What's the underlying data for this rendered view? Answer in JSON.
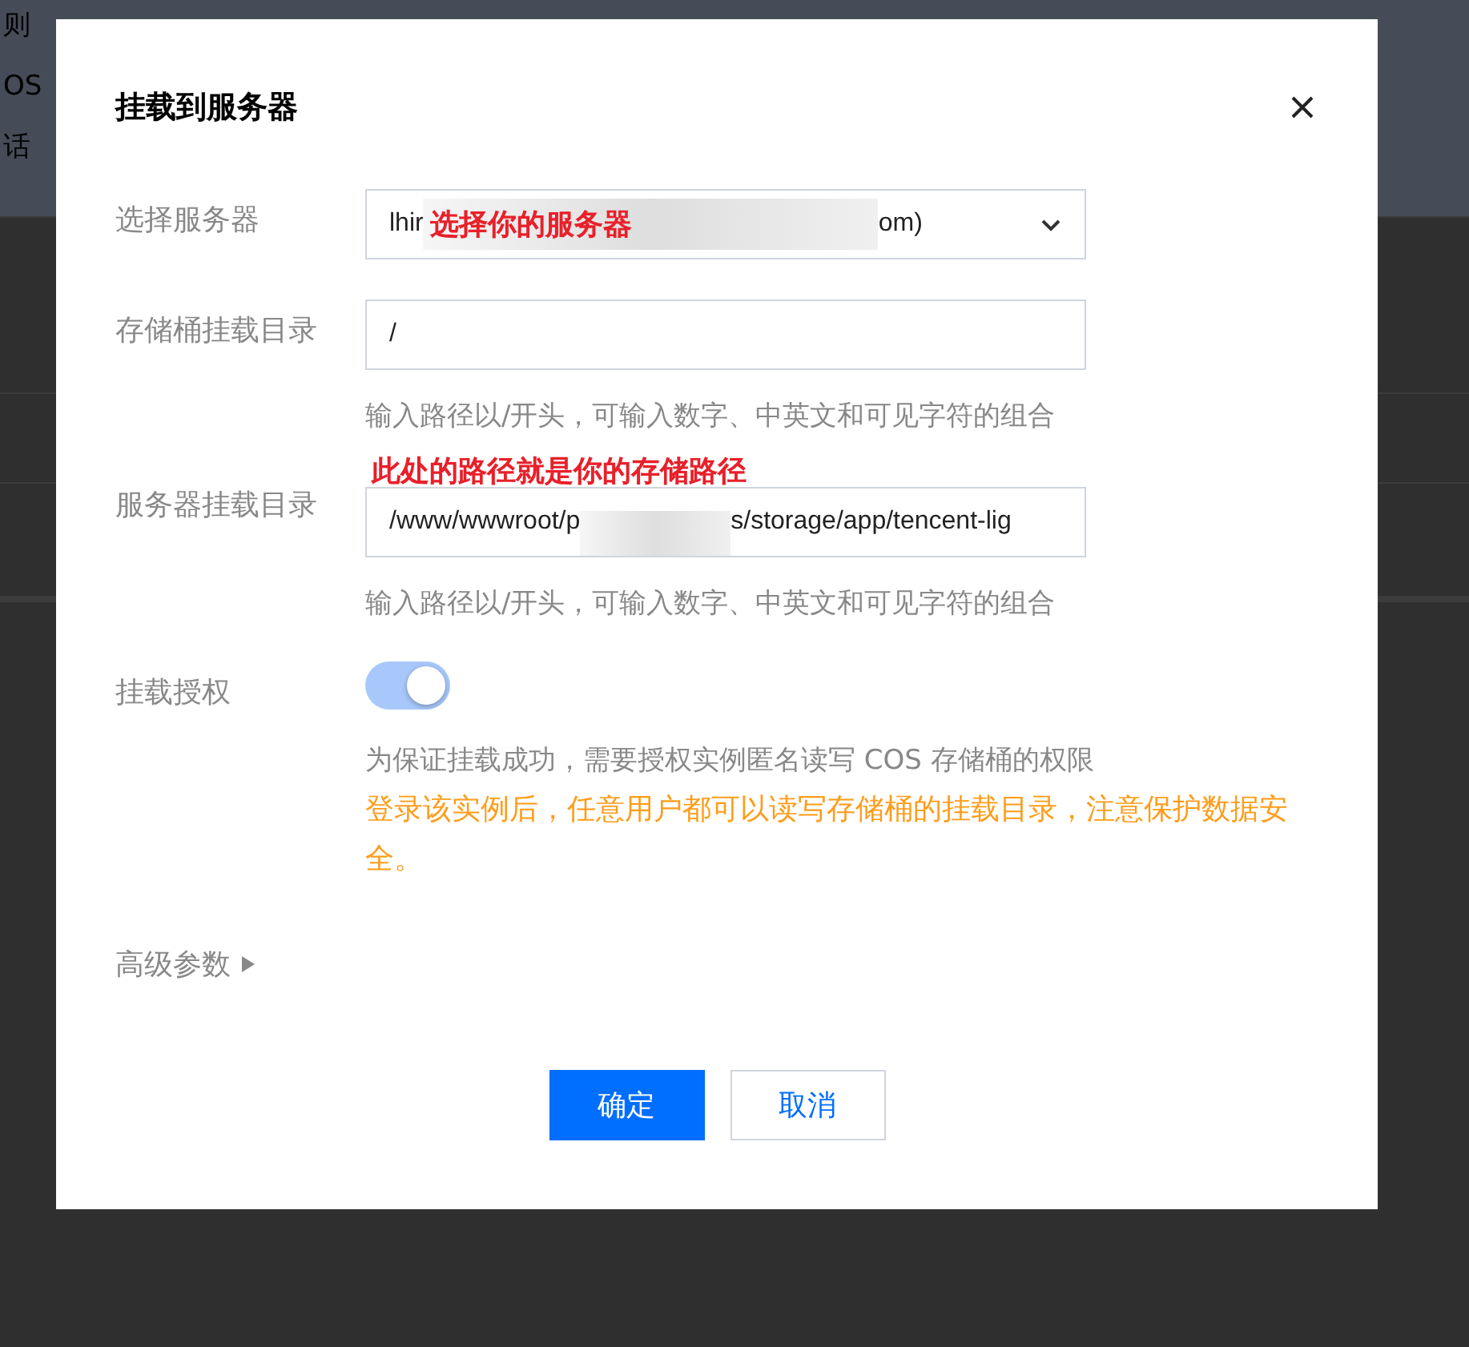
{
  "background_page": {
    "lines": [
      "则",
      "OS",
      "话"
    ]
  },
  "dialog": {
    "title": "挂载到服务器",
    "fields": [
      {
        "kind": "select",
        "label": "选择服务器",
        "value_start": "lhir",
        "value_end": "om)",
        "annotation": "选择你的服务器"
      },
      {
        "kind": "input",
        "label": "存储桶挂载目录",
        "value": "/",
        "hint": "输入路径以/开头，可输入数字、中英文和可见字符的组合"
      },
      {
        "kind": "input",
        "label": "服务器挂载目录",
        "annotation": "此处的路径就是你的存储路径",
        "value_start": "/www/wwwroot/p",
        "value_end": "s/storage/app/tencent-lig",
        "hint": "输入路径以/开头，可输入数字、中英文和可见字符的组合"
      },
      {
        "kind": "toggle",
        "label": "挂载授权",
        "on": true,
        "description": "为保证挂载成功，需要授权实例匿名读写 COS 存储桶的权限",
        "warning": "登录该实例后，任意用户都可以读写存储桶的挂载目录，注意保护数据安全。"
      }
    ],
    "advanced": {
      "label": "高级参数",
      "expanded": false
    },
    "buttons": [
      {
        "label": "确定",
        "kind": "primary"
      },
      {
        "label": "取消",
        "kind": "secondary"
      }
    ]
  }
}
